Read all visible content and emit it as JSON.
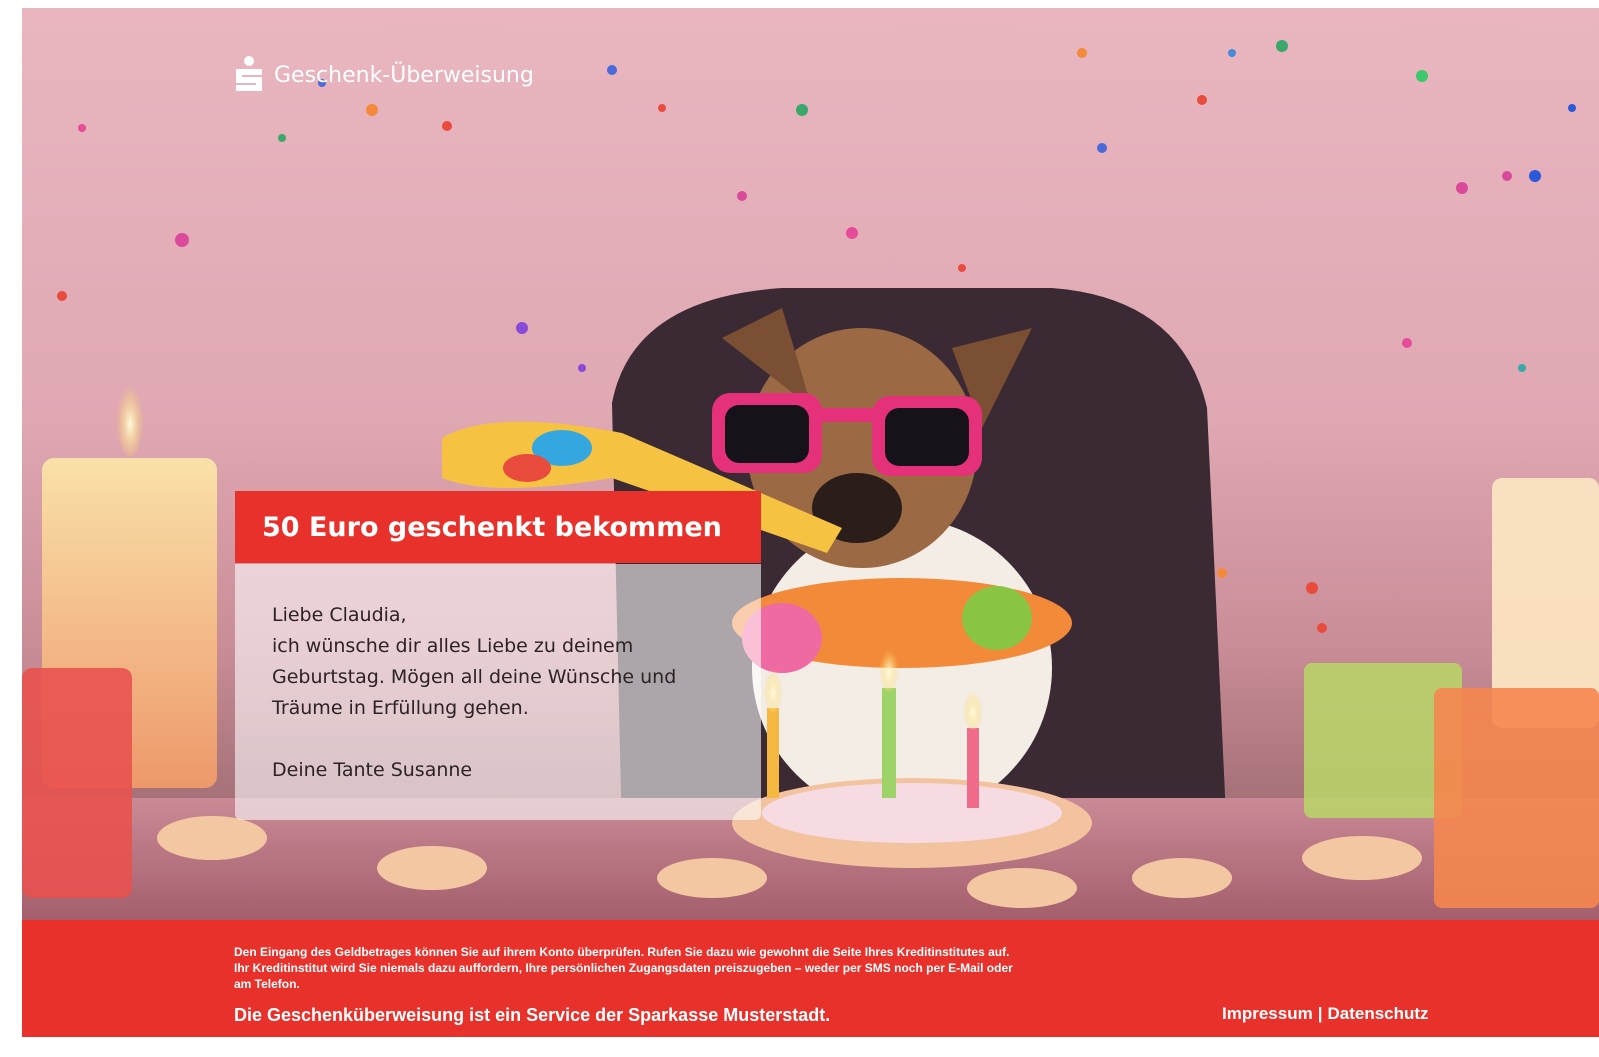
{
  "brand": {
    "logo_icon": "sparkasse-s-logo-icon",
    "title": "Geschenk-Überweisung"
  },
  "hero": {
    "image_icon": "birthday-dog-party-photo",
    "headline": "50 Euro geschenkt bekommen"
  },
  "message": {
    "greeting": "Liebe Claudia,",
    "lines": [
      "ich wünsche dir alles Liebe zu deinem",
      "Geburtstag. Mögen all deine Wünsche und",
      "Träume in Erfüllung gehen."
    ],
    "signature": "Deine Tante Susanne"
  },
  "footer": {
    "notice_lines": [
      "Den Eingang des Geldbetrages können Sie auf ihrem Konto überprüfen. Rufen Sie dazu wie gewohnt die Seite Ihres Kreditinstitutes auf.",
      "Ihr Kreditinstitut wird Sie niemals dazu auffordern, Ihre persönlichen Zugangsdaten preiszugeben – weder per SMS noch per E-Mail oder",
      "am Telefon."
    ],
    "service_text": "Die Geschenküberweisung ist ein Service der Sparkasse Musterstadt.",
    "impressum_label": "Impressum",
    "separator": "|",
    "datenschutz_label": "Datenschutz"
  },
  "colors": {
    "brand_red": "#e8312b",
    "card_text": "#2b2325"
  }
}
